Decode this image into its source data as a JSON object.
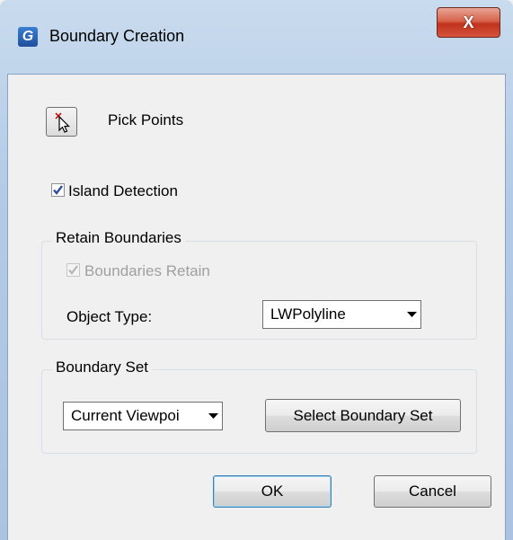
{
  "window": {
    "title": "Boundary Creation",
    "app_icon_letter": "G",
    "close_glyph": "X"
  },
  "pick_points": {
    "label": "Pick Points",
    "icon": "pick-points-cursor-icon"
  },
  "island_detection": {
    "label": "Island Detection",
    "checked": true
  },
  "retain_boundaries": {
    "group_title": "Retain Boundaries",
    "boundaries_retain": {
      "label": "Boundaries Retain",
      "checked": true,
      "disabled": true
    },
    "object_type": {
      "label": "Object Type:",
      "selected": "LWPolyline"
    }
  },
  "boundary_set": {
    "group_title": "Boundary Set",
    "selected": "Current Viewpoi",
    "select_button": "Select Boundary Set"
  },
  "buttons": {
    "ok": "OK",
    "cancel": "Cancel"
  }
}
